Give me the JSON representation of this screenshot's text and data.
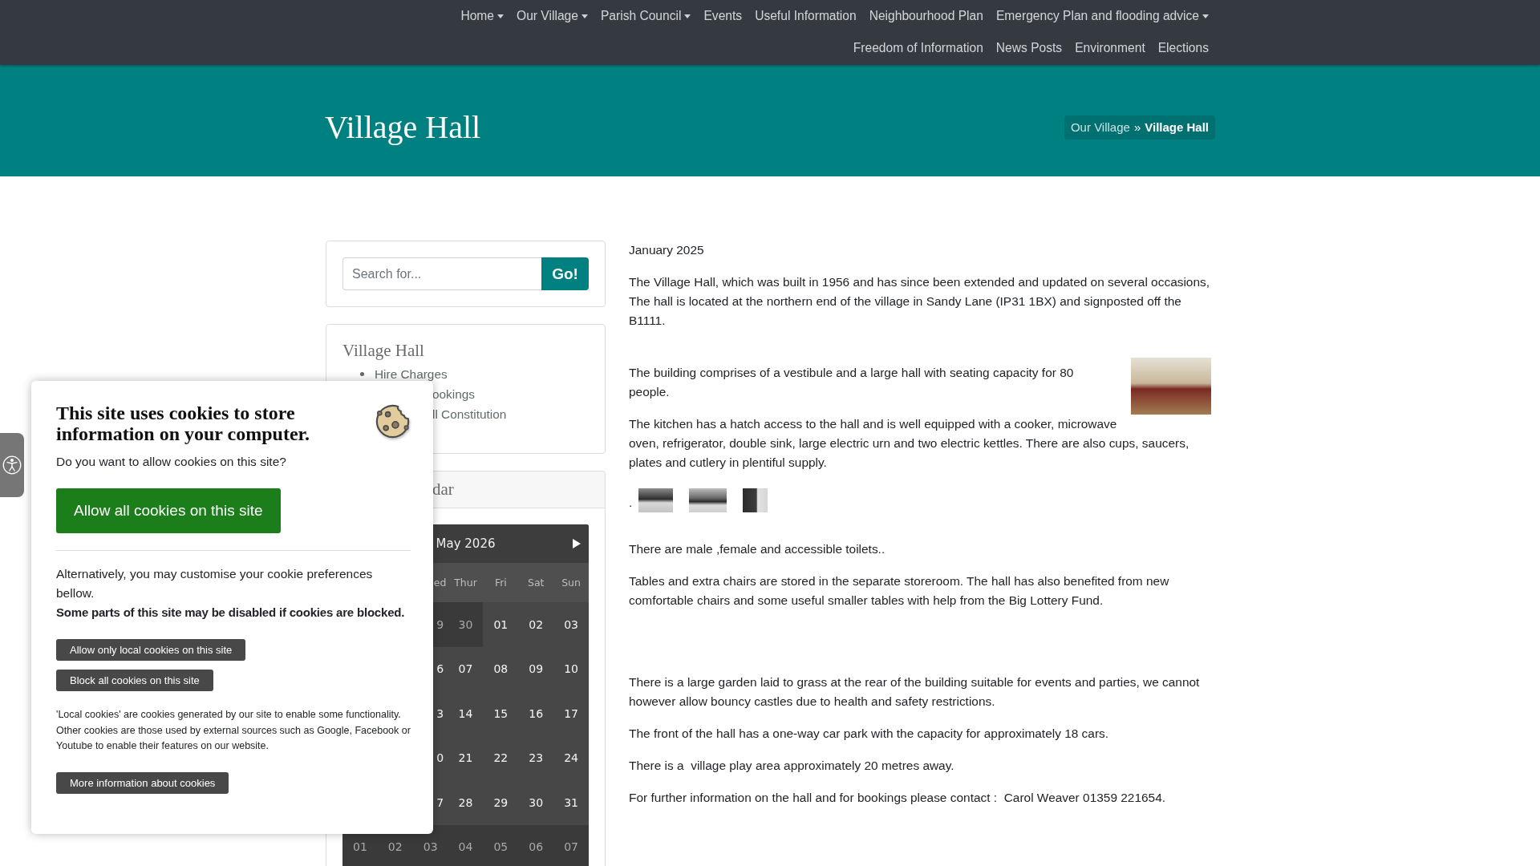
{
  "nav": {
    "items": [
      {
        "label": "Home",
        "dropdown": true
      },
      {
        "label": "Our Village",
        "dropdown": true
      },
      {
        "label": "Parish Council",
        "dropdown": true
      },
      {
        "label": "Events",
        "dropdown": false
      },
      {
        "label": "Useful Information",
        "dropdown": false
      },
      {
        "label": "Neighbourhood Plan",
        "dropdown": false
      },
      {
        "label": "Emergency Plan and flooding advice",
        "dropdown": true
      },
      {
        "label": "Freedom of Information",
        "dropdown": false
      },
      {
        "label": "News Posts",
        "dropdown": false
      },
      {
        "label": "Environment",
        "dropdown": false
      },
      {
        "label": "Elections",
        "dropdown": false
      }
    ]
  },
  "banner": {
    "title": "Village Hall",
    "separator": "»",
    "breadcrumb": [
      {
        "label": "Our Village",
        "current": false
      },
      {
        "label": "Village Hall",
        "current": true
      }
    ]
  },
  "search": {
    "placeholder": "Search for...",
    "button": "Go!"
  },
  "section_menu": {
    "title": "Village Hall",
    "items": [
      {
        "label": "Hire Charges",
        "covered": false
      },
      {
        "label": "ookings",
        "covered": true
      },
      {
        "label": "ll Constitution",
        "covered": true
      }
    ]
  },
  "calendar": {
    "title": "dar",
    "month": "May 2026",
    "weekdays": [
      "ed",
      "Thur",
      "Fri",
      "Sat",
      "Sun"
    ],
    "weeks": [
      [
        {
          "day": "9",
          "other_month": true
        },
        {
          "day": "30",
          "other_month": true
        },
        {
          "day": "01",
          "other_month": false
        },
        {
          "day": "02",
          "other_month": false
        },
        {
          "day": "03",
          "other_month": false
        }
      ],
      [
        {
          "day": "6",
          "other_month": false
        },
        {
          "day": "07",
          "other_month": false
        },
        {
          "day": "08",
          "other_month": false
        },
        {
          "day": "09",
          "other_month": false
        },
        {
          "day": "10",
          "other_month": false
        }
      ],
      [
        {
          "day": "3",
          "other_month": false
        },
        {
          "day": "14",
          "other_month": false
        },
        {
          "day": "15",
          "other_month": false
        },
        {
          "day": "16",
          "other_month": false
        },
        {
          "day": "17",
          "other_month": false
        }
      ],
      [
        {
          "day": "0",
          "other_month": false
        },
        {
          "day": "21",
          "other_month": false
        },
        {
          "day": "22",
          "other_month": false
        },
        {
          "day": "23",
          "other_month": false
        },
        {
          "day": "24",
          "other_month": false
        }
      ],
      [
        {
          "day": "7",
          "other_month": false
        },
        {
          "day": "28",
          "other_month": false
        },
        {
          "day": "29",
          "other_month": false
        },
        {
          "day": "30",
          "other_month": false
        },
        {
          "day": "31",
          "other_month": false
        }
      ],
      [
        {
          "day": "01",
          "other_month": true
        },
        {
          "day": "02",
          "other_month": true
        },
        {
          "day": "03",
          "other_month": true
        },
        {
          "day": "04",
          "other_month": true
        },
        {
          "day": "05",
          "other_month": true
        },
        {
          "day": "06",
          "other_month": true
        },
        {
          "day": "07",
          "other_month": true
        }
      ]
    ]
  },
  "article": {
    "date": "January 2025",
    "intro": "The Village Hall, which was built in 1956 and has since been extended and updated on several occasions, The hall is located at the northern end of the village in Sandy Lane (IP31 1BX) and signposted off the B1111.",
    "building": "The building comprises of a vestibule and a large hall with seating capacity for 80 people.",
    "kitchen": "The kitchen has a hatch access to the hall and is well equipped with a cooker, microwave oven, refrigerator, double sink, large electric urn and two electric kettles. There are also cups, saucers, plates and cutlery in plentiful supply.",
    "thumbnails_lead": ".",
    "facilities": [
      "There are male ,female and accessible toilets..",
      "Tables and extra chairs are stored in the separate storeroom. The hall has also benefited from new comfortable chairs and some useful smaller tables with help from the Big Lottery Fund."
    ],
    "grounds": [
      "There is a large garden laid to grass at the rear of the building suitable for events and parties, we cannot however allow bouncy castles due to health and safety restrictions.",
      "The front of the hall has a one-way car park with the capacity for approximately 18 cars.",
      "There is a  village play area approximately 20 metres away.",
      "For further information on the hall and for bookings please contact :  Carol Weaver 01359 221654."
    ]
  },
  "cookie_popup": {
    "title": "This site uses cookies to store information on your computer.",
    "question": "Do you want to allow cookies on this site?",
    "allow_all": "Allow all cookies on this site",
    "alternative": "Alternatively, you may customise your cookie preferences bellow.",
    "warning": "Some parts of this site may be disabled if cookies are blocked.",
    "options": [
      "Allow only local cookies on this site",
      "Block all cookies on this site"
    ],
    "note": "'Local cookies' are cookies generated by our site to enable some functionality. Other cookies are those used by external sources such as Google, Facebook or Youtube to enable their features on our website.",
    "more_info": "More information about cookies"
  }
}
